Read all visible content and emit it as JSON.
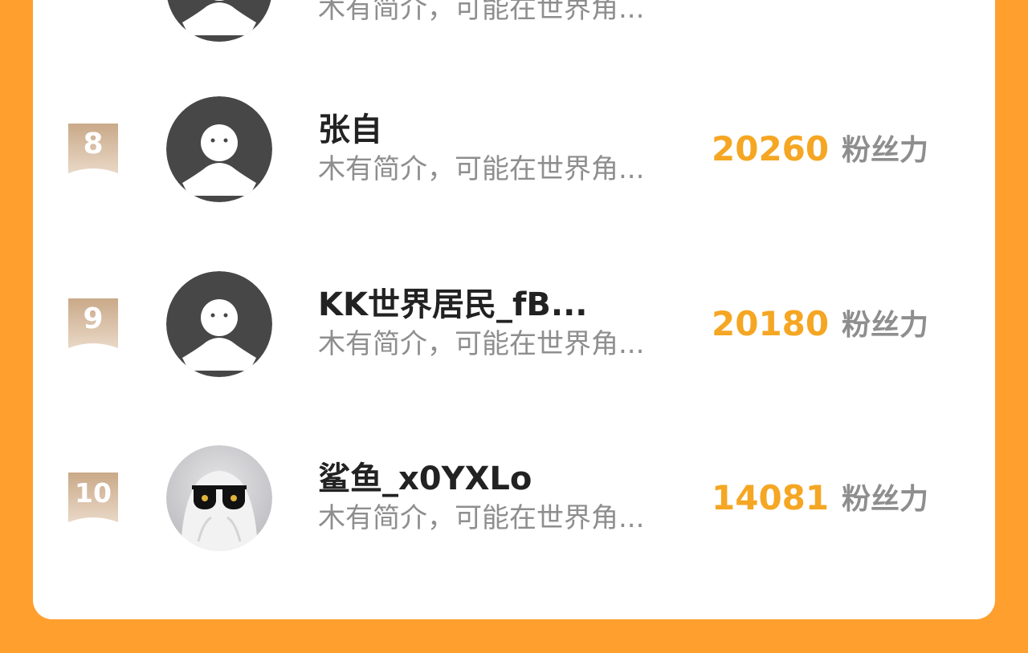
{
  "ranking": {
    "score_unit": "粉丝力",
    "rows": [
      {
        "rank": "",
        "name": "",
        "description": "木有简介，可能在世界角...",
        "score": "",
        "avatar_icon": "default-person-avatar-icon"
      },
      {
        "rank": "8",
        "name": "张自",
        "description": "木有简介，可能在世界角...",
        "score": "20260",
        "avatar_icon": "default-person-avatar-icon"
      },
      {
        "rank": "9",
        "name": "KK世界居民_fB...",
        "description": "木有简介，可能在世界角...",
        "score": "20180",
        "avatar_icon": "default-person-avatar-icon"
      },
      {
        "rank": "10",
        "name": "鲨鱼_x0YXLo",
        "description": "木有简介，可能在世界角...",
        "score": "14081",
        "avatar_icon": "ghost-sunglasses-avatar-icon"
      }
    ]
  },
  "colors": {
    "background": "#FF9F2E",
    "card": "#FFFFFF",
    "score": "#F5A623",
    "muted_text": "#8E8E8E",
    "name_text": "#222222",
    "rank_badge": "#D9BCA0",
    "avatar_dark": "#474747"
  }
}
